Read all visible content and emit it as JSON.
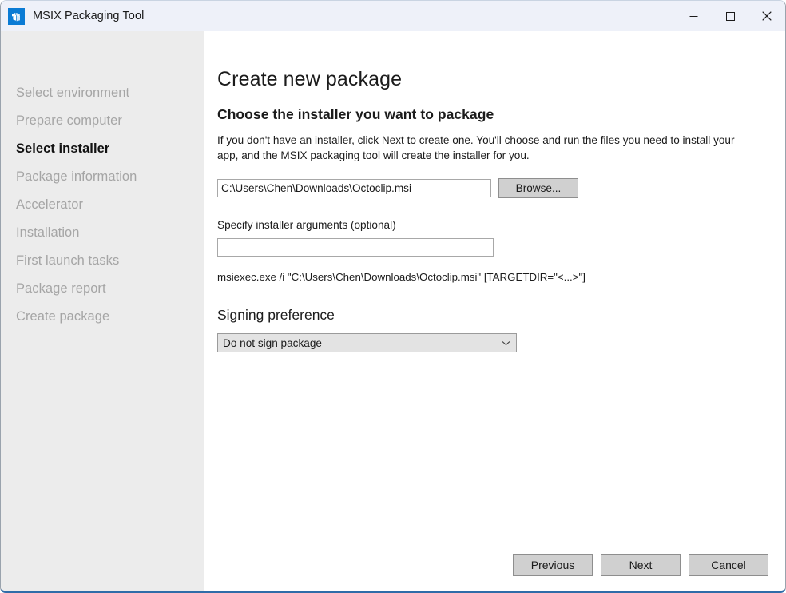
{
  "window": {
    "title": "MSIX Packaging Tool",
    "app_icon": "package-box-icon",
    "accent_color": "#0a7bd4",
    "frame_color": "#2f6ca8",
    "controls": {
      "minimize": "minimize-icon",
      "maximize": "maximize-icon",
      "close": "close-icon"
    }
  },
  "sidebar": {
    "items": [
      {
        "label": "Select environment",
        "active": false
      },
      {
        "label": "Prepare computer",
        "active": false
      },
      {
        "label": "Select installer",
        "active": true
      },
      {
        "label": "Package information",
        "active": false
      },
      {
        "label": "Accelerator",
        "active": false
      },
      {
        "label": "Installation",
        "active": false
      },
      {
        "label": "First launch tasks",
        "active": false
      },
      {
        "label": "Package report",
        "active": false
      },
      {
        "label": "Create package",
        "active": false
      }
    ]
  },
  "main": {
    "page_title": "Create new package",
    "section_title": "Choose the installer you want to package",
    "description": "If you don't have an installer, click Next to create one. You'll choose and run the files you need to install your app, and the MSIX packaging tool will create the installer for you.",
    "installer_path": {
      "value": "C:\\Users\\Chen\\Downloads\\Octoclip.msi",
      "placeholder": ""
    },
    "browse_label": "Browse...",
    "arguments_label": "Specify installer arguments (optional)",
    "arguments_value": "",
    "arguments_placeholder": "",
    "command_preview": "msiexec.exe /i \"C:\\Users\\Chen\\Downloads\\Octoclip.msi\"  [TARGETDIR=\"<...>\"]",
    "signing": {
      "title": "Signing preference",
      "selected": "Do not sign package",
      "chevron": "chevron-down-icon"
    }
  },
  "footer": {
    "previous_label": "Previous",
    "next_label": "Next",
    "cancel_label": "Cancel"
  }
}
